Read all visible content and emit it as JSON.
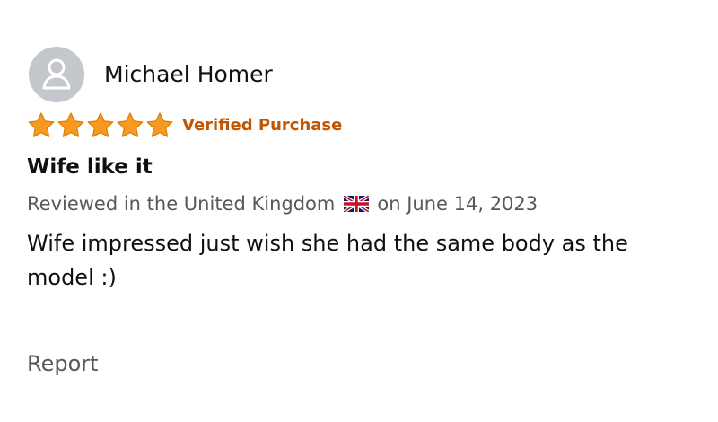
{
  "reviewer": {
    "name": "Michael Homer",
    "avatar_icon": "user-avatar-icon"
  },
  "rating": {
    "stars": 5,
    "max_stars": 5,
    "star_color": "#f79a1f",
    "verified_label": "Verified Purchase",
    "verified_color": "#c45500"
  },
  "review": {
    "title": "Wife like it",
    "meta_prefix": "Reviewed in the United Kingdom",
    "flag_icon": "uk-flag-icon",
    "meta_date": "on June 14, 2023",
    "body": "Wife impressed just wish she had the same body as the model :)",
    "report_label": "Report"
  }
}
